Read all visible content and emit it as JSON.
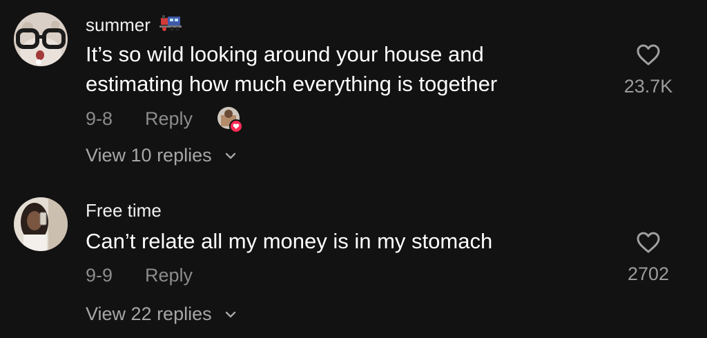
{
  "comments": [
    {
      "username": "summer",
      "username_emoji": "train-icon",
      "text_lines": [
        "It’s so wild looking around your house and",
        "estimating how much everything is together"
      ],
      "date": "9-8",
      "reply_label": "Reply",
      "liked_by_creator": true,
      "view_replies_label": "View 10 replies",
      "like_count": "23.7K"
    },
    {
      "username": "Free time",
      "text_lines": [
        "Can’t relate all my money is in my stomach"
      ],
      "date": "9-9",
      "reply_label": "Reply",
      "liked_by_creator": false,
      "view_replies_label": "View 22 replies",
      "like_count": "2702"
    }
  ],
  "colors": {
    "background": "#131212",
    "primary_text": "#ffffff",
    "secondary_text": "#8c8c8c",
    "creator_like_badge": "#fe2c55"
  }
}
